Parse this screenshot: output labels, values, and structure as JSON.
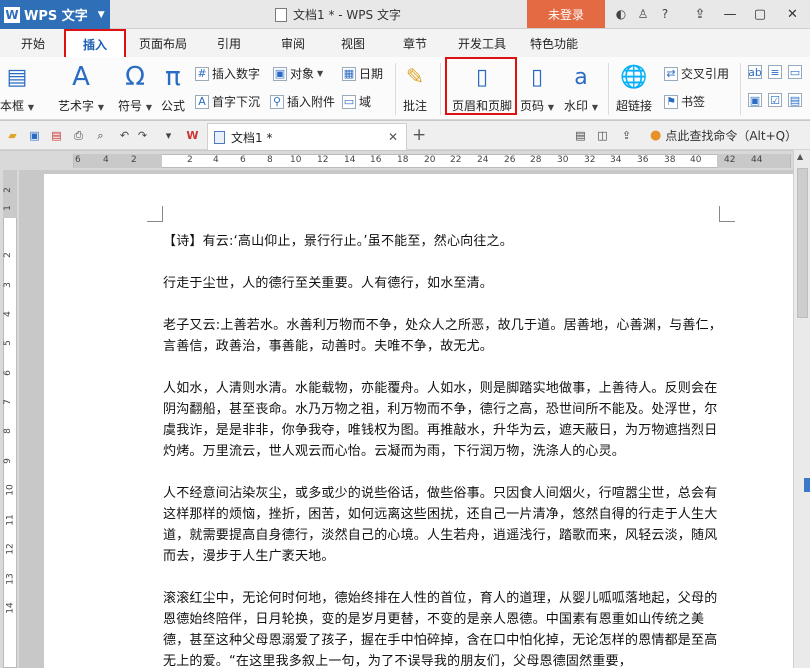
{
  "app": {
    "name": "WPS 文字",
    "logo": "W"
  },
  "window": {
    "doc_title": "文档1 * - WPS 文字",
    "login": "未登录"
  },
  "menu_tabs": [
    "开始",
    "插入",
    "页面布局",
    "引用",
    "审阅",
    "视图",
    "章节",
    "开发工具",
    "特色功能"
  ],
  "active_tab": "插入",
  "ribbon": {
    "textbox": "本框",
    "wordart": "艺术字",
    "symbol": "符号",
    "formula": "公式",
    "insert_number": "插入数字",
    "object": "对象",
    "date": "日期",
    "drop_cap": "首字下沉",
    "insert_attachment": "插入附件",
    "field": "域",
    "comment": "批注",
    "header_footer": "页眉和页脚",
    "page_number": "页码",
    "watermark": "水印",
    "hyperlink": "超链接",
    "cross_ref": "交叉引用",
    "bookmark": "书签"
  },
  "doc_tab": {
    "label": "文档1 *"
  },
  "find_command": "点此查找命令（Alt+Q）",
  "ruler": {
    "h_numbers": [
      "6",
      "4",
      "2",
      "2",
      "4",
      "6",
      "8",
      "10",
      "12",
      "14",
      "16",
      "18",
      "20",
      "22",
      "24",
      "26",
      "28",
      "30",
      "32",
      "34",
      "36",
      "38",
      "40",
      "42",
      "44"
    ],
    "v_numbers": [
      "2",
      "1",
      "2",
      "3",
      "4",
      "5",
      "6",
      "7",
      "8",
      "9",
      "10",
      "11",
      "12",
      "13",
      "14"
    ]
  },
  "document": {
    "paragraphs": [
      "【诗】有云:‘高山仰止，景行行止。’虽不能至，然心向往之。",
      "行走于尘世，人的德行至关重要。人有德行，如水至清。",
      "老子又云:上善若水。水善利万物而不争，处众人之所恶，故几于道。居善地，心善渊，与善仁，言善信，政善治，事善能，动善时。夫唯不争，故无尤。",
      "人如水，人清则水清。水能载物，亦能覆舟。人如水，则是脚踏实地做事，上善待人。反则会在阴沟翻船，甚至丧命。水乃万物之祖，利万物而不争，德行之高，恐世间所不能及。处浮世，尔虞我诈，是是非非，你争我夺，唯钱权为图。再推敲水，升华为云，遮天蔽日，为万物遮挡烈日灼烤。万里流云，世人观云而心怡。云凝而为雨，下行润万物，洗涤人的心灵。",
      "人不经意间沾染灰尘，或多或少的说些俗话，做些俗事。只因食人间烟火，行喧嚣尘世，总会有这样那样的烦恼，挫折，困苦，如何远离这些困扰，还自己一片清净，悠然自得的行走于人生大道，就需要提高自身德行，淡然自己的心境。人生若舟，逍遥浅行，踏歌而来，风轻云淡，随风而去，漫步于人生广袤天地。",
      "滚滚红尘中，无论何时何地，德始终排在人性的首位，育人的道理，从婴儿呱呱落地起，父母的恩德始终陪伴，日月轮换，变的是岁月更替，不变的是亲人恩德。中国素有恩重如山传统之美德，甚至这种父母恩溺爱了孩子，握在手中怕碎掉，含在口中怕化掉，无论怎样的恩情都是至高无上的爱。“在这里我多叙上一句，为了不误导我的朋友们，父母恩德固然重要，"
    ]
  }
}
